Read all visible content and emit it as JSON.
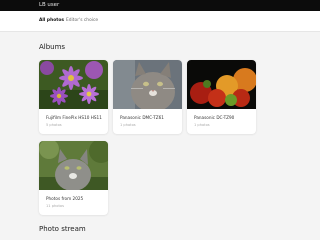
{
  "topbar": {
    "user_label": "LB user"
  },
  "nav": {
    "tabs": [
      {
        "label": "All photos"
      },
      {
        "label": "Editor's choice"
      }
    ]
  },
  "albums": {
    "heading": "Albums",
    "items": [
      {
        "title": "Fujifilm FinePix HS10 HS11",
        "count": "5 photos",
        "thumbnail": "purple-flowers"
      },
      {
        "title": "Panasonic DMC-TZ61",
        "count": "1 photos",
        "thumbnail": "cat-portrait"
      },
      {
        "title": "Panasonic DC-TZ90",
        "count": "1 photos",
        "thumbnail": "tomatoes"
      },
      {
        "title": "Photos from 2025",
        "count": "11 photos",
        "thumbnail": "cat-in-garden"
      }
    ]
  },
  "photo_stream": {
    "heading": "Photo stream"
  },
  "colors": {
    "topbar": "#0c0c0c",
    "background": "#f4f4f4",
    "card": "#ffffff"
  }
}
